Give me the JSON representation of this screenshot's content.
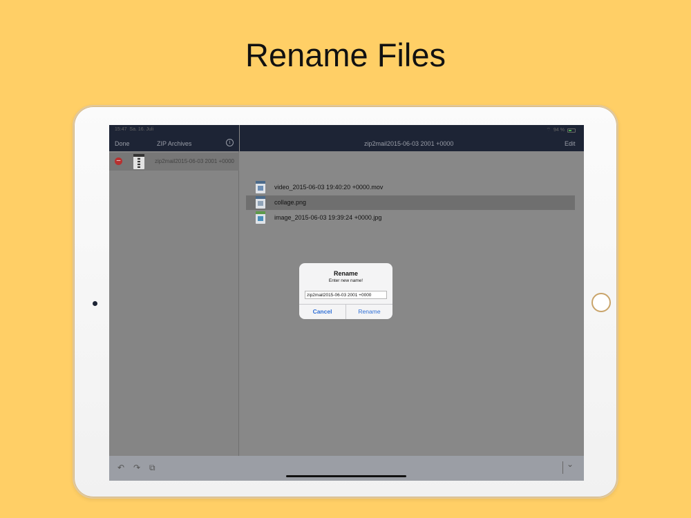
{
  "headline": "Rename Files",
  "status": {
    "time": "15:47",
    "date": "Sa. 16. Juli",
    "battery": "94 %"
  },
  "sidebar": {
    "done_label": "Done",
    "title": "ZIP Archives",
    "archives": [
      {
        "name": "zip2mail2015-06-03 2001 +0000"
      }
    ]
  },
  "main": {
    "title": "zip2mail2015-06-03 2001 +0000",
    "edit_label": "Edit",
    "files": [
      {
        "name": "video_2015-06-03 19:40:20 +0000.mov",
        "icon": "video-file-icon"
      },
      {
        "name": "collage.png",
        "icon": "png-file-icon"
      },
      {
        "name": "image_2015-06-03 19:39:24 +0000.jpg",
        "icon": "image-file-icon"
      }
    ]
  },
  "dialog": {
    "title": "Rename",
    "message": "Enter new name!",
    "input_value": "zip2mail2015-06-03 2001 +0000",
    "cancel_label": "Cancel",
    "confirm_label": "Rename"
  },
  "toolbar": {
    "undo_icon": "↶",
    "redo_icon": "↷",
    "copy_icon": "⧉",
    "chevron_icon": "⌄"
  },
  "colors": {
    "background": "#FFCF66",
    "nav": "#1d2435",
    "accent": "#2f6fd6"
  }
}
